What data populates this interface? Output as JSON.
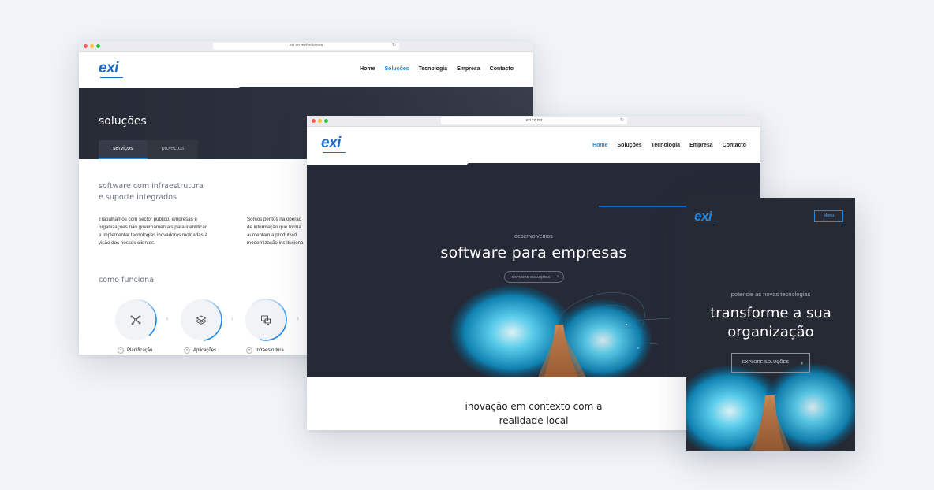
{
  "brand": {
    "logo_text": "exi",
    "accent": "#1e88e5",
    "dark_bg": "#262a36"
  },
  "win_solucoes": {
    "url": "exi.co.mz/solucoes",
    "nav": [
      "Home",
      "Soluções",
      "Tecnologia",
      "Empresa",
      "Contacto"
    ],
    "active_nav": "Soluções",
    "page_title": "soluções",
    "tabs": [
      "serviços",
      "projectos"
    ],
    "active_tab": "serviços",
    "subheading_line1": "software com infraestrutura",
    "subheading_line2": "e suporte integrados",
    "para_left": [
      "Trabalhamos com sector público, empresas e",
      "organizações não governamentais para identificar",
      "e implementar tecnologias inovadoras moldadas à",
      "visão dos nossos clientes."
    ],
    "para_right": [
      "Somos peritos na operac",
      "de informação que forma",
      "aumentam a produtivid",
      "modernização instituciona"
    ],
    "como_funciona": "como funciona",
    "steps": [
      {
        "num": "1",
        "label": "Planificação",
        "icon": "network-icon"
      },
      {
        "num": "2",
        "label": "Aplicações",
        "icon": "layers-icon"
      },
      {
        "num": "3",
        "label": "Infraestrutura",
        "icon": "monitor-icon"
      }
    ]
  },
  "win_home": {
    "url": "exi.co.mz",
    "nav": [
      "Home",
      "Soluções",
      "Tecnologia",
      "Empresa",
      "Contacto"
    ],
    "active_nav": "Home",
    "kicker": "desenvolvemos",
    "title": "software para empresas",
    "cta": "EXPLORE SOLUÇÕES",
    "section_line1": "inovação em contexto com a",
    "section_line2": "realidade local"
  },
  "win_mobile": {
    "menu_label": "Menu",
    "kicker": "potencie as novas tecnologias",
    "title_line1": "transforme a sua",
    "title_line2": "organização",
    "cta": "EXPLORE SOLUÇÕES"
  }
}
